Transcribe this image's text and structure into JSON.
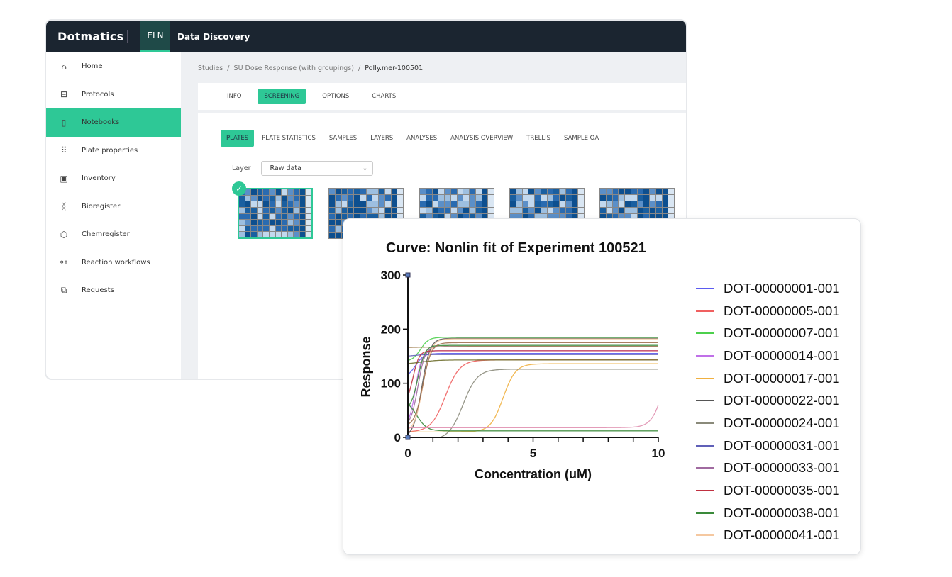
{
  "header": {
    "logo": "Dotmatics",
    "app": "ELN",
    "section": "Data Discovery"
  },
  "sidebar": {
    "items": [
      {
        "label": "Home",
        "icon": "home-icon",
        "glyph": "⌂"
      },
      {
        "label": "Protocols",
        "icon": "briefcase-icon",
        "glyph": "⊟"
      },
      {
        "label": "Notebooks",
        "icon": "notebook-icon",
        "glyph": "▯",
        "active": true
      },
      {
        "label": "Plate properties",
        "icon": "grid-icon",
        "glyph": "⠿"
      },
      {
        "label": "Inventory",
        "icon": "box-icon",
        "glyph": "▣"
      },
      {
        "label": "Bioregister",
        "icon": "dna-icon",
        "glyph": "ᛝ"
      },
      {
        "label": "Chemregister",
        "icon": "hexagon-icon",
        "glyph": "⬡"
      },
      {
        "label": "Reaction workflows",
        "icon": "workflow-icon",
        "glyph": "⚯"
      },
      {
        "label": "Requests",
        "icon": "requests-icon",
        "glyph": "⧉"
      }
    ]
  },
  "breadcrumb": {
    "items": [
      "Studies",
      "SU Dose Response (with groupings)"
    ],
    "current": "Polly.mer-100501",
    "sep": "/"
  },
  "tabs": [
    {
      "label": "INFO"
    },
    {
      "label": "SCREENING",
      "active": true
    },
    {
      "label": "OPTIONS"
    },
    {
      "label": "CHARTS"
    }
  ],
  "subtabs": [
    {
      "label": "PLATES",
      "active": true
    },
    {
      "label": "PLATE STATISTICS"
    },
    {
      "label": "SAMPLES"
    },
    {
      "label": "LAYERS"
    },
    {
      "label": "ANALYSES"
    },
    {
      "label": "ANALYSIS OVERVIEW"
    },
    {
      "label": "TRELLIS"
    },
    {
      "label": "SAMPLE QA"
    }
  ],
  "layer": {
    "label": "Layer",
    "value": "Raw data"
  },
  "colors": {
    "accent": "#2ec896",
    "header": "#1b2530"
  },
  "chart_data": {
    "type": "line",
    "title": "Curve: Nonlin fit of Experiment 100521",
    "xlabel": "Concentration (uM)",
    "ylabel": "Response",
    "xlim": [
      0,
      10
    ],
    "ylim": [
      0,
      300
    ],
    "xticks": [
      "0",
      "5",
      "10"
    ],
    "yticks": [
      "0",
      "100",
      "200",
      "300"
    ],
    "legend": "right",
    "grid": false,
    "series": [
      {
        "name": "DOT-00000001-001",
        "color": "#5b5bf0",
        "bottom": 110,
        "top": 155,
        "ec50": 0.3,
        "hill": 6
      },
      {
        "name": "DOT-00000005-001",
        "color": "#f06060",
        "bottom": 10,
        "top": 143,
        "ec50": 1.5,
        "hill": 3.5
      },
      {
        "name": "DOT-00000007-001",
        "color": "#4cd04c",
        "bottom": 140,
        "top": 185,
        "ec50": 0.5,
        "hill": 6
      },
      {
        "name": "DOT-00000014-001",
        "color": "#c070e8",
        "bottom": 20,
        "top": 160,
        "ec50": 0.3,
        "hill": 8
      },
      {
        "name": "DOT-00000017-001",
        "color": "#f0b040",
        "bottom": 10,
        "top": 136,
        "ec50": 3.8,
        "hill": 4
      },
      {
        "name": "DOT-00000022-001",
        "color": "#555555",
        "bottom": 0,
        "top": 183,
        "ec50": 0.55,
        "hill": 6
      },
      {
        "name": "DOT-00000024-001",
        "color": "#8a8a7a",
        "bottom": -5,
        "top": 126,
        "ec50": 2.2,
        "hill": 3.5
      },
      {
        "name": "DOT-00000031-001",
        "color": "#6060b8",
        "bottom": 150,
        "top": 153,
        "ec50": 0.3,
        "hill": 6
      },
      {
        "name": "DOT-00000033-001",
        "color": "#a06aa0",
        "bottom": 20,
        "top": 168,
        "ec50": 0.4,
        "hill": 7
      },
      {
        "name": "DOT-00000035-001",
        "color": "#c03040",
        "bottom": 60,
        "top": 160,
        "ec50": 0.2,
        "hill": 8
      },
      {
        "name": "DOT-00000038-001",
        "color": "#3a8a3a",
        "bottom": 70,
        "top": 12,
        "ec50": 0.35,
        "hill": 5
      },
      {
        "name": "DOT-00000041-001",
        "color": "#f5c8a0",
        "bottom": 10,
        "top": 182,
        "ec50": 0.6,
        "hill": 6
      },
      {
        "color": "#e090b0",
        "bottom": 18,
        "top": 200,
        "ec50": 10.3,
        "hill": 4
      },
      {
        "color": "#a08050",
        "bottom": 166,
        "top": 168,
        "ec50": 1,
        "hill": 2
      },
      {
        "color": "#707030",
        "bottom": 135,
        "top": 143,
        "ec50": 0.5,
        "hill": 3
      },
      {
        "color": "#3a8a3a",
        "bottom": 50,
        "top": 170,
        "ec50": 0.4,
        "hill": 7
      },
      {
        "color": "#a07050",
        "bottom": 20,
        "top": 175,
        "ec50": 0.6,
        "hill": 6
      }
    ]
  }
}
